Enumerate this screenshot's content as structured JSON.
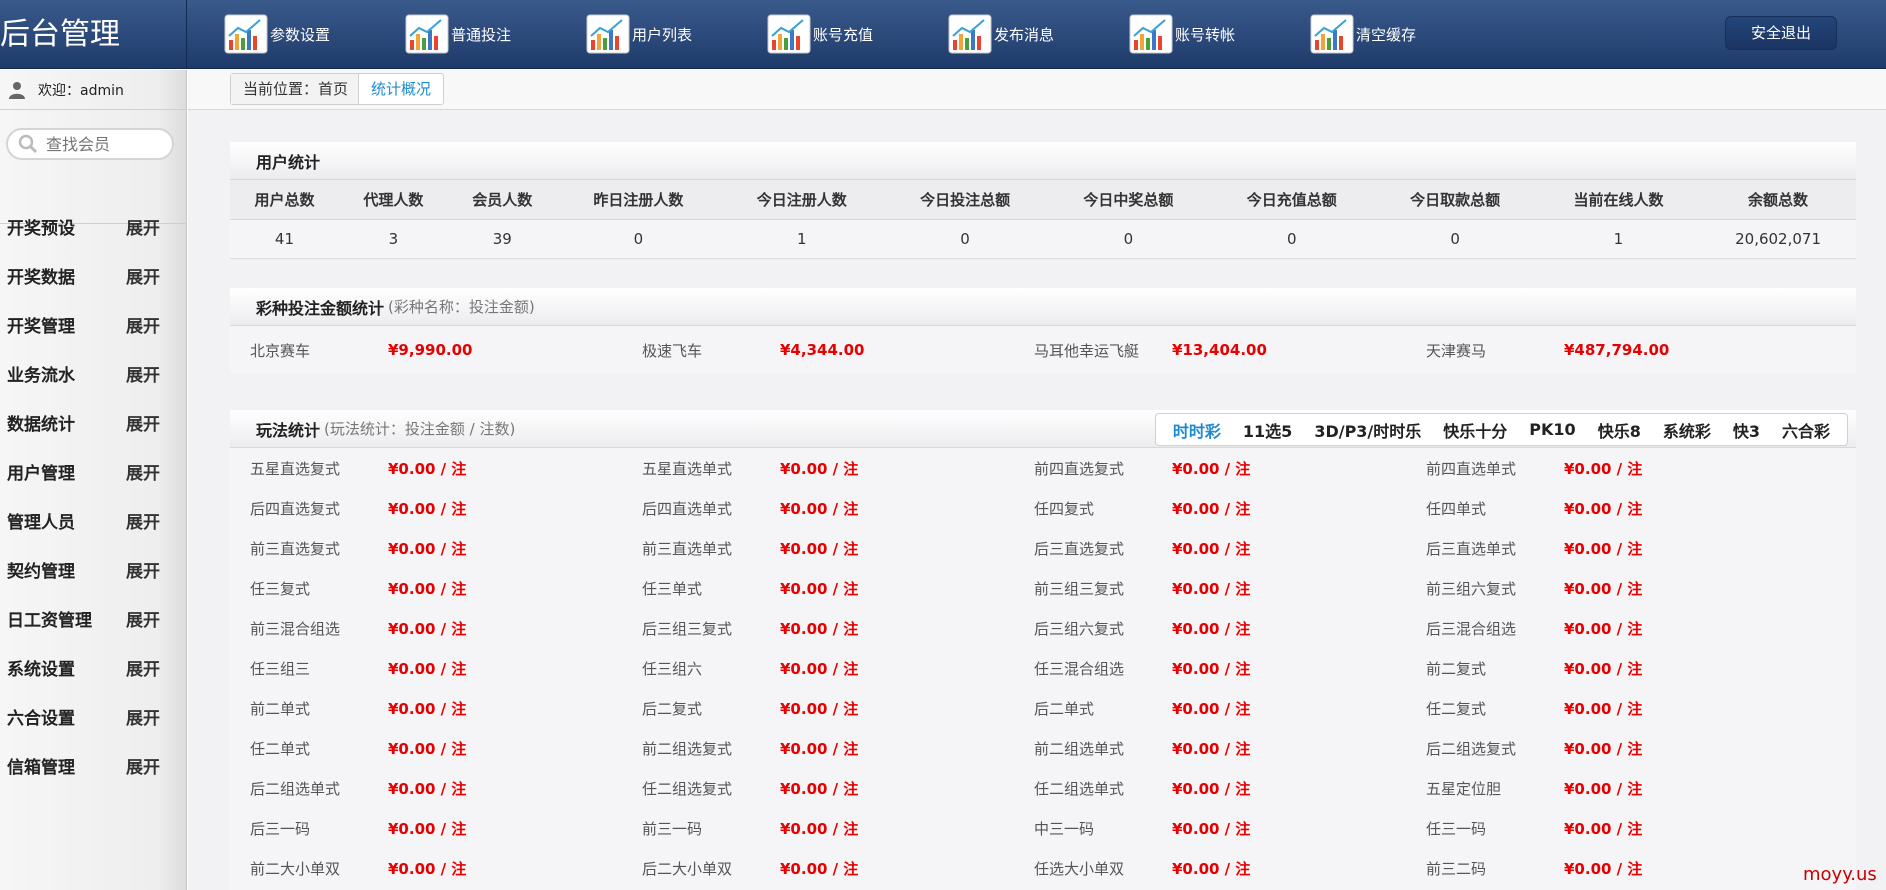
{
  "app": {
    "title": "后台管理",
    "logout_label": "安全退出"
  },
  "nav": [
    {
      "label": "参数设置",
      "icon": "chart-icon"
    },
    {
      "label": "普通投注",
      "icon": "chart-icon"
    },
    {
      "label": "用户列表",
      "icon": "chart-icon"
    },
    {
      "label": "账号充值",
      "icon": "chart-icon"
    },
    {
      "label": "发布消息",
      "icon": "chart-icon"
    },
    {
      "label": "账号转帐",
      "icon": "chart-icon"
    },
    {
      "label": "清空缓存",
      "icon": "chart-icon"
    }
  ],
  "sidebar": {
    "welcome": "欢迎：admin",
    "search_placeholder": "查找会员",
    "toggle_label": "展开",
    "items": [
      {
        "label": "开奖预设"
      },
      {
        "label": "开奖数据"
      },
      {
        "label": "开奖管理"
      },
      {
        "label": "业务流水"
      },
      {
        "label": "数据统计"
      },
      {
        "label": "用户管理"
      },
      {
        "label": "管理人员"
      },
      {
        "label": "契约管理"
      },
      {
        "label": "日工资管理"
      },
      {
        "label": "系统设置"
      },
      {
        "label": "六合设置"
      },
      {
        "label": "信箱管理"
      }
    ]
  },
  "breadcrumb": {
    "home": "当前位置：首页",
    "current": "统计概况"
  },
  "user_stats": {
    "title": "用户统计",
    "headers": [
      "用户总数",
      "代理人数",
      "会员人数",
      "昨日注册人数",
      "今日注册人数",
      "今日投注总额",
      "今日中奖总额",
      "今日充值总额",
      "今日取款总额",
      "当前在线人数",
      "余额总数"
    ],
    "values": [
      "41",
      "3",
      "39",
      "0",
      "1",
      "0",
      "0",
      "0",
      "0",
      "1",
      "20,602,071"
    ]
  },
  "lottery_stats": {
    "title": "彩种投注金额统计",
    "subtitle": "(彩种名称：投注金额)",
    "items": [
      {
        "name": "北京赛车",
        "amount": "¥9,990.00"
      },
      {
        "name": "极速飞车",
        "amount": "¥4,344.00"
      },
      {
        "name": "马耳他幸运飞艇",
        "amount": "¥13,404.00"
      },
      {
        "name": "天津赛马",
        "amount": "¥487,794.00"
      }
    ]
  },
  "play_stats": {
    "title": "玩法统计",
    "subtitle": "(玩法统计：投注金额 / 注数)",
    "tabs": [
      "时时彩",
      "11选5",
      "3D/P3/时时乐",
      "快乐十分",
      "PK10",
      "快乐8",
      "系统彩",
      "快3",
      "六合彩"
    ],
    "active_tab": "时时彩",
    "items": [
      {
        "name": "五星直选复式",
        "value": "¥0.00 / 注"
      },
      {
        "name": "五星直选单式",
        "value": "¥0.00 / 注"
      },
      {
        "name": "前四直选复式",
        "value": "¥0.00 / 注"
      },
      {
        "name": "前四直选单式",
        "value": "¥0.00 / 注"
      },
      {
        "name": "后四直选复式",
        "value": "¥0.00 / 注"
      },
      {
        "name": "后四直选单式",
        "value": "¥0.00 / 注"
      },
      {
        "name": "任四复式",
        "value": "¥0.00 / 注"
      },
      {
        "name": "任四单式",
        "value": "¥0.00 / 注"
      },
      {
        "name": "前三直选复式",
        "value": "¥0.00 / 注"
      },
      {
        "name": "前三直选单式",
        "value": "¥0.00 / 注"
      },
      {
        "name": "后三直选复式",
        "value": "¥0.00 / 注"
      },
      {
        "name": "后三直选单式",
        "value": "¥0.00 / 注"
      },
      {
        "name": "任三复式",
        "value": "¥0.00 / 注"
      },
      {
        "name": "任三单式",
        "value": "¥0.00 / 注"
      },
      {
        "name": "前三组三复式",
        "value": "¥0.00 / 注"
      },
      {
        "name": "前三组六复式",
        "value": "¥0.00 / 注"
      },
      {
        "name": "前三混合组选",
        "value": "¥0.00 / 注"
      },
      {
        "name": "后三组三复式",
        "value": "¥0.00 / 注"
      },
      {
        "name": "后三组六复式",
        "value": "¥0.00 / 注"
      },
      {
        "name": "后三混合组选",
        "value": "¥0.00 / 注"
      },
      {
        "name": "任三组三",
        "value": "¥0.00 / 注"
      },
      {
        "name": "任三组六",
        "value": "¥0.00 / 注"
      },
      {
        "name": "任三混合组选",
        "value": "¥0.00 / 注"
      },
      {
        "name": "前二复式",
        "value": "¥0.00 / 注"
      },
      {
        "name": "前二单式",
        "value": "¥0.00 / 注"
      },
      {
        "name": "后二复式",
        "value": "¥0.00 / 注"
      },
      {
        "name": "后二单式",
        "value": "¥0.00 / 注"
      },
      {
        "name": "任二复式",
        "value": "¥0.00 / 注"
      },
      {
        "name": "任二单式",
        "value": "¥0.00 / 注"
      },
      {
        "name": "前二组选复式",
        "value": "¥0.00 / 注"
      },
      {
        "name": "前二组选单式",
        "value": "¥0.00 / 注"
      },
      {
        "name": "后二组选复式",
        "value": "¥0.00 / 注"
      },
      {
        "name": "后二组选单式",
        "value": "¥0.00 / 注"
      },
      {
        "name": "任二组选复式",
        "value": "¥0.00 / 注"
      },
      {
        "name": "任二组选单式",
        "value": "¥0.00 / 注"
      },
      {
        "name": "五星定位胆",
        "value": "¥0.00 / 注"
      },
      {
        "name": "后三一码",
        "value": "¥0.00 / 注"
      },
      {
        "name": "前三一码",
        "value": "¥0.00 / 注"
      },
      {
        "name": "中三一码",
        "value": "¥0.00 / 注"
      },
      {
        "name": "任三一码",
        "value": "¥0.00 / 注"
      },
      {
        "name": "前二大小单双",
        "value": "¥0.00 / 注"
      },
      {
        "name": "后二大小单双",
        "value": "¥0.00 / 注"
      },
      {
        "name": "任选大小单双",
        "value": "¥0.00 / 注"
      },
      {
        "name": "前三二码",
        "value": "¥0.00 / 注"
      }
    ]
  },
  "watermark": "moyy.us",
  "colors": {
    "header": "#2a4a7c",
    "accent": "#1e8bd0",
    "amount": "#e60000"
  }
}
